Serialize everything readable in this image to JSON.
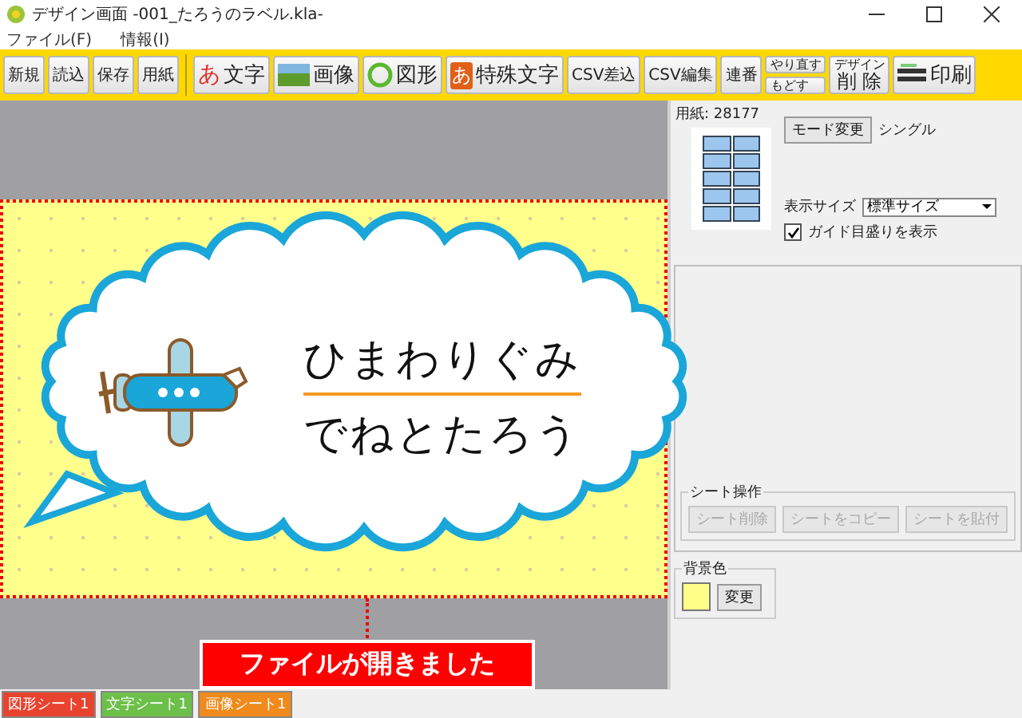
{
  "window": {
    "title": "デザイン画面 -001_たろうのラベル.kla-"
  },
  "menu": [
    "ファイル(F)",
    "情報(I)"
  ],
  "toolbar": {
    "file_buttons": [
      "新規",
      "読込",
      "保存",
      "用紙"
    ],
    "tool_buttons": [
      {
        "kind": "char",
        "glyph": "あ",
        "label": "文字"
      },
      {
        "kind": "image",
        "label": "画像"
      },
      {
        "kind": "circle",
        "label": "図形"
      },
      {
        "kind": "char_box",
        "glyph": "あ",
        "label": "特殊文字"
      },
      {
        "kind": "text",
        "label": "CSV差込"
      },
      {
        "kind": "text",
        "label": "CSV編集"
      },
      {
        "kind": "text",
        "label": "連番"
      },
      {
        "kind": "stack",
        "labels": [
          "やり直す",
          "もどす"
        ]
      },
      {
        "kind": "caption",
        "caption": "デザイン",
        "label": "削 除"
      },
      {
        "kind": "printer",
        "label": "印刷"
      }
    ]
  },
  "label": {
    "lines": [
      "ひまわりぐみ",
      "でねとたろう"
    ]
  },
  "panel": {
    "paper": "用紙: 28177",
    "mode_button": "モード変更",
    "mode": "シングル",
    "size_label": "表示サイズ",
    "size_value": "標準サイズ",
    "guide": {
      "label": "ガイド目盛りを表示",
      "checked": true
    },
    "sheet_ops": {
      "title": "シート操作",
      "buttons": [
        {
          "label": "シート削除",
          "disabled": true
        },
        {
          "label": "シートをコピー",
          "disabled": true
        },
        {
          "label": "シートを貼付",
          "disabled": true
        }
      ]
    },
    "background": {
      "title": "背景色",
      "button": "変更"
    }
  },
  "sheet_tabs": [
    {
      "label": "図形シート1",
      "color": "#e8432f"
    },
    {
      "label": "文字シート1",
      "color": "#6cc04a"
    },
    {
      "label": "画像シート1",
      "color": "#f08a1c"
    }
  ],
  "toast": "ファイルが開きました"
}
